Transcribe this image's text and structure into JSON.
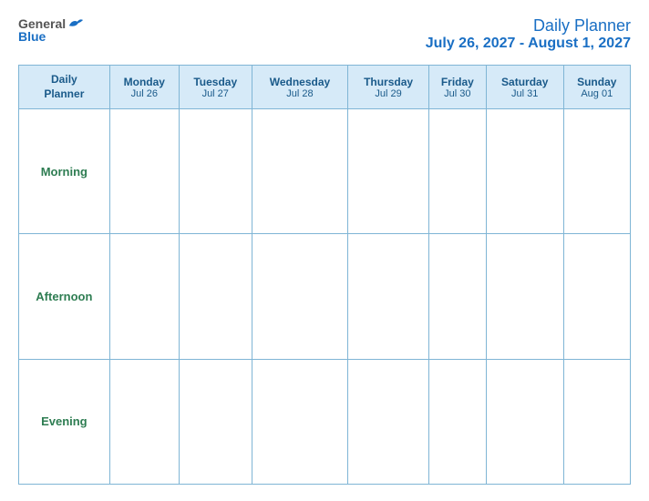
{
  "logo": {
    "general": "General",
    "blue": "Blue"
  },
  "header": {
    "title": "Daily Planner",
    "date_range": "July 26, 2027 - August 1, 2027"
  },
  "table": {
    "header_label_line1": "Daily",
    "header_label_line2": "Planner",
    "columns": [
      {
        "day": "Monday",
        "date": "Jul 26"
      },
      {
        "day": "Tuesday",
        "date": "Jul 27"
      },
      {
        "day": "Wednesday",
        "date": "Jul 28"
      },
      {
        "day": "Thursday",
        "date": "Jul 29"
      },
      {
        "day": "Friday",
        "date": "Jul 30"
      },
      {
        "day": "Saturday",
        "date": "Jul 31"
      },
      {
        "day": "Sunday",
        "date": "Aug 01"
      }
    ],
    "rows": [
      {
        "label": "Morning"
      },
      {
        "label": "Afternoon"
      },
      {
        "label": "Evening"
      }
    ]
  }
}
